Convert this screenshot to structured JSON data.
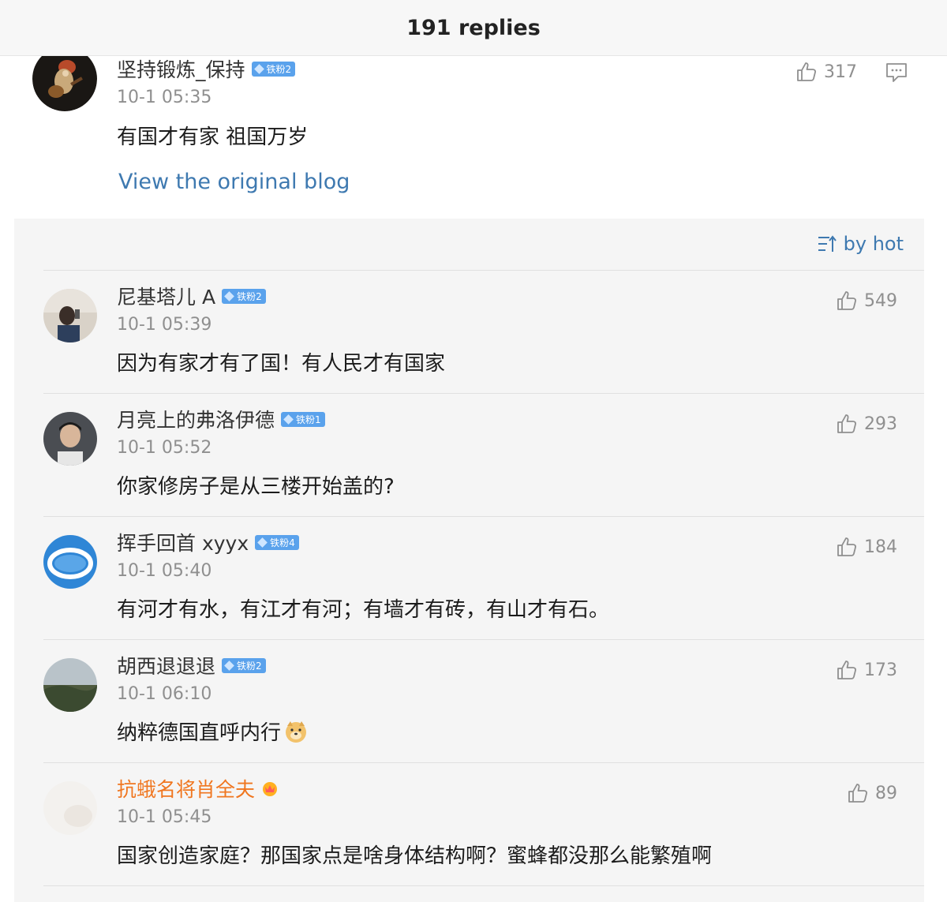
{
  "header": {
    "title": "191 replies"
  },
  "main_comment": {
    "username": "坚持锻炼_保持",
    "badge": "铁粉2",
    "time": "10-1 05:35",
    "text": "有国才有家 祖国万岁",
    "likes": "317",
    "view_original": "View the original blog"
  },
  "sort": {
    "label": "by hot"
  },
  "replies": [
    {
      "username": "尼基塔儿 A",
      "badge": "铁粉2",
      "time": "10-1 05:39",
      "text": "因为有家才有了国！有人民才有国家",
      "likes": "549"
    },
    {
      "username": "月亮上的弗洛伊德",
      "badge": "铁粉1",
      "time": "10-1 05:52",
      "text": "你家修房子是从三楼开始盖的?",
      "likes": "293"
    },
    {
      "username": "挥手回首 xyyx",
      "badge": "铁粉4",
      "time": "10-1 05:40",
      "text": "有河才有水，有江才有河；有墙才有砖，有山才有石。",
      "likes": "184"
    },
    {
      "username": "胡西退退退",
      "badge": "铁粉2",
      "time": "10-1 06:10",
      "text": "纳粹德国直呼内行",
      "likes": "173"
    },
    {
      "username": "抗蛾名将肖全夫",
      "time": "10-1 05:45",
      "text": "国家创造家庭？那国家点是啥身体结构啊？蜜蜂都没那么能繁殖啊",
      "likes": "89"
    }
  ],
  "colors": {
    "link": "#3e79b0",
    "badge": "#5aa2ec",
    "vip_name": "#f0761f",
    "panel_bg": "#f5f5f5"
  },
  "icons": {
    "like": "thumbs-up-icon",
    "reply": "comment-icon",
    "sort": "sort-icon",
    "emoji": "doge-emoji-icon",
    "vip": "vip-crown-icon"
  }
}
